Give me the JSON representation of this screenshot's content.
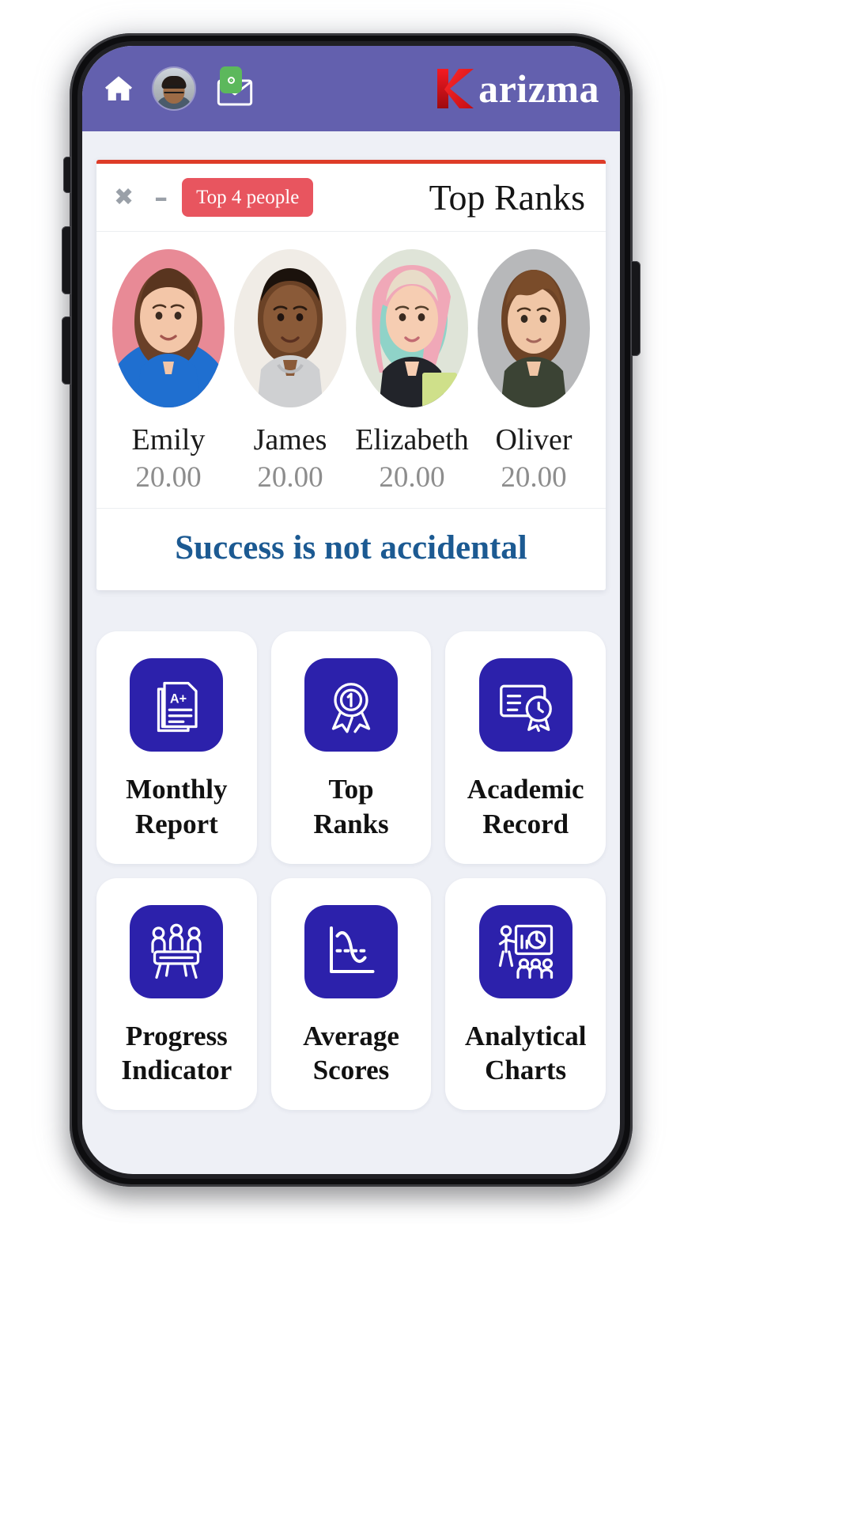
{
  "topbar": {
    "home_icon": "home-icon",
    "avatar_label": "user-avatar",
    "mail_icon": "mail-icon",
    "mail_badge_dot": "notification-dot",
    "brand_mark": "K",
    "brand_text": "arizma",
    "bg_color": "#6360ae",
    "brand_color": "#ee1c25"
  },
  "rank_card": {
    "accent_color": "#de3c28",
    "close_label": "✖",
    "minimize_label": "–",
    "badge_label": "Top 4 people",
    "badge_color": "#e8555f",
    "title": "Top Ranks",
    "people": [
      {
        "name": "Emily",
        "score": "20.00"
      },
      {
        "name": "James",
        "score": "20.00"
      },
      {
        "name": "Elizabeth",
        "score": "20.00"
      },
      {
        "name": "Oliver",
        "score": "20.00"
      }
    ],
    "quote": "Success is not accidental",
    "quote_color": "#1c5a92"
  },
  "tiles": {
    "icon_bg": "#2c21ab",
    "items": [
      {
        "label": "Monthly\nReport",
        "icon": "document-grade-icon"
      },
      {
        "label": "Top\nRanks",
        "icon": "award-medal-icon"
      },
      {
        "label": "Academic\nRecord",
        "icon": "certificate-badge-icon"
      },
      {
        "label": "Progress\nIndicator",
        "icon": "group-meeting-icon"
      },
      {
        "label": "Average\nScores",
        "icon": "line-chart-icon"
      },
      {
        "label": "Analytical\nCharts",
        "icon": "presentation-chart-icon"
      }
    ]
  }
}
